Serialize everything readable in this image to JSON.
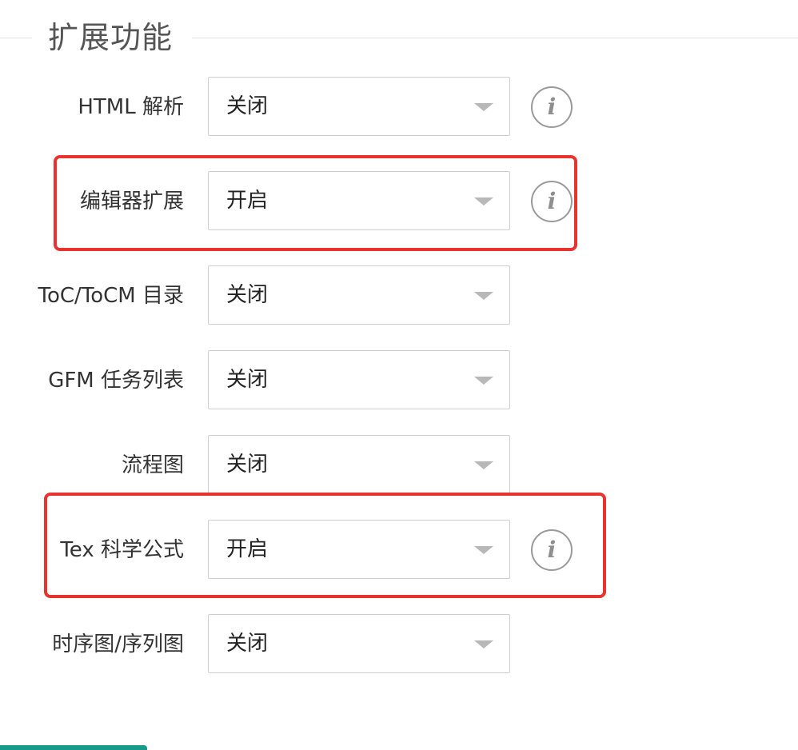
{
  "section": {
    "title": "扩展功能"
  },
  "settings": [
    {
      "label": "HTML 解析",
      "value": "关闭",
      "info_icon": true
    },
    {
      "label": "编辑器扩展",
      "value": "开启",
      "info_icon": true
    },
    {
      "label": "ToC/ToCM 目录",
      "value": "关闭",
      "info_icon": false
    },
    {
      "label": "GFM 任务列表",
      "value": "关闭",
      "info_icon": false
    },
    {
      "label": "流程图",
      "value": "关闭",
      "info_icon": false
    },
    {
      "label": "Tex 科学公式",
      "value": "开启",
      "info_icon": true
    },
    {
      "label": "时序图/序列图",
      "value": "关闭",
      "info_icon": false
    }
  ],
  "colors": {
    "highlight": "#e8332e",
    "border": "#cfcfcf",
    "caret": "#b8b8b8",
    "info_icon": "#9a9a9a",
    "bottom_accent": "#179a8a"
  },
  "icons": {
    "info": "info-icon",
    "caret": "caret-down-icon"
  },
  "info_glyph": "i"
}
